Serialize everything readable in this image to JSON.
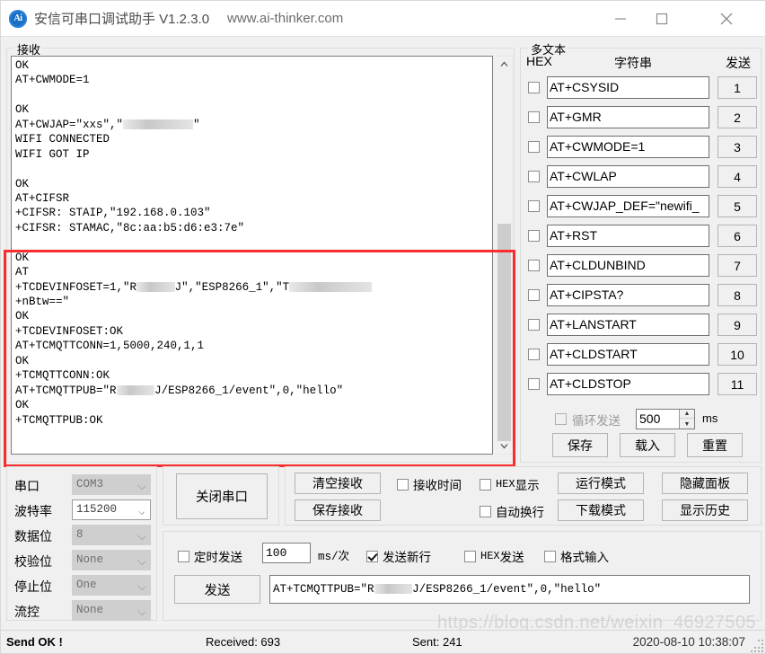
{
  "window": {
    "title": "安信可串口调试助手 V1.2.3.0",
    "url": "www.ai-thinker.com",
    "logo_text": "Ai",
    "minimize_icon": "minimize-icon",
    "maximize_icon": "maximize-icon",
    "close_icon": "close-icon"
  },
  "receive": {
    "group_label": "接收",
    "content": "OK\nAT+CWMODE=1\n\nOK\nAT+CWJAP=\"xxs\",\"███████████\"\nWIFI CONNECTED\nWIFI GOT IP\n\nOK\nAT+CIFSR\n+CIFSR: STAIP,\"192.168.0.103\"\n+CIFSR: STAMAC,\"8c:aa:b5:d6:e3:7e\"\n\nOK\nAT\n+TCDEVINFOSET=1,\"R██████J\",\"ESP8266_1\",\"T█████████████\n+nBtw==\"\nOK\n+TCDEVINFOSET:OK\nAT+TCMQTTCONN=1,5000,240,1,1\nOK\n+TCMQTTCONN:OK\nAT+TCMQTTPUB=\"R██████J/ESP8266_1/event\",0,\"hello\"\nOK\n+TCMQTTPUB:OK",
    "scroll_up_icon": "chevron-up-icon",
    "scroll_down_icon": "chevron-down-icon"
  },
  "highlight": {
    "color": "#fb2c2c"
  },
  "multitext": {
    "group_label": "多文本",
    "col_hex": "HEX",
    "col_string": "字符串",
    "col_send": "发送",
    "rows": [
      {
        "checked": false,
        "command": "AT+CSYSID",
        "send_label": "1"
      },
      {
        "checked": false,
        "command": "AT+GMR",
        "send_label": "2"
      },
      {
        "checked": false,
        "command": "AT+CWMODE=1",
        "send_label": "3"
      },
      {
        "checked": false,
        "command": "AT+CWLAP",
        "send_label": "4"
      },
      {
        "checked": false,
        "command": "AT+CWJAP_DEF=\"newifi_",
        "send_label": "5"
      },
      {
        "checked": false,
        "command": "AT+RST",
        "send_label": "6"
      },
      {
        "checked": false,
        "command": "AT+CLDUNBIND",
        "send_label": "7"
      },
      {
        "checked": false,
        "command": "AT+CIPSTA?",
        "send_label": "8"
      },
      {
        "checked": false,
        "command": "AT+LANSTART",
        "send_label": "9"
      },
      {
        "checked": false,
        "command": "AT+CLDSTART",
        "send_label": "10"
      },
      {
        "checked": false,
        "command": "AT+CLDSTOP",
        "send_label": "11"
      }
    ],
    "loop_send_label": "循环发送",
    "loop_send_checked": false,
    "loop_interval": "500",
    "loop_unit": "ms",
    "save_label": "保存",
    "load_label": "载入",
    "reset_label": "重置"
  },
  "serial": {
    "fields": [
      {
        "label": "串口",
        "value": "COM3",
        "enabled": false
      },
      {
        "label": "波特率",
        "value": "115200",
        "enabled": true
      },
      {
        "label": "数据位",
        "value": "8",
        "enabled": false
      },
      {
        "label": "校验位",
        "value": "None",
        "enabled": false
      },
      {
        "label": "停止位",
        "value": "One",
        "enabled": false
      },
      {
        "label": "流控",
        "value": "None",
        "enabled": false
      }
    ],
    "toggle_port_label": "关闭串口"
  },
  "recv_tools": {
    "clear_label": "清空接收",
    "save_label": "保存接收",
    "recv_time_label": "接收时间",
    "recv_time_checked": false,
    "hex_show_label_hex": "HEX",
    "hex_show_label_cn": "显示",
    "hex_show_checked": false,
    "auto_wrap_label": "自动换行",
    "auto_wrap_checked": false,
    "run_mode_label": "运行模式",
    "download_mode_label": "下载模式",
    "hide_panel_label": "隐藏面板",
    "show_history_label": "显示历史"
  },
  "send": {
    "timed_send_label": "定时发送",
    "timed_send_checked": false,
    "timed_interval": "100",
    "timed_unit": "ms/次",
    "newline_label": "发送新行",
    "newline_checked": true,
    "hex_send_label_hex": "HEX",
    "hex_send_label_cn": "发送",
    "hex_send_checked": false,
    "format_input_label": "格式输入",
    "format_input_checked": false,
    "send_button_label": "发送",
    "input_value": "AT+TCMQTTPUB=\"R██████J/ESP8266_1/event\",0,\"hello\""
  },
  "statusbar": {
    "message": "Send OK !",
    "received": "Received: 693",
    "sent": "Sent: 241",
    "time": "2020-08-10 10:38:07"
  },
  "watermark": "https://blog.csdn.net/weixin_46927505"
}
